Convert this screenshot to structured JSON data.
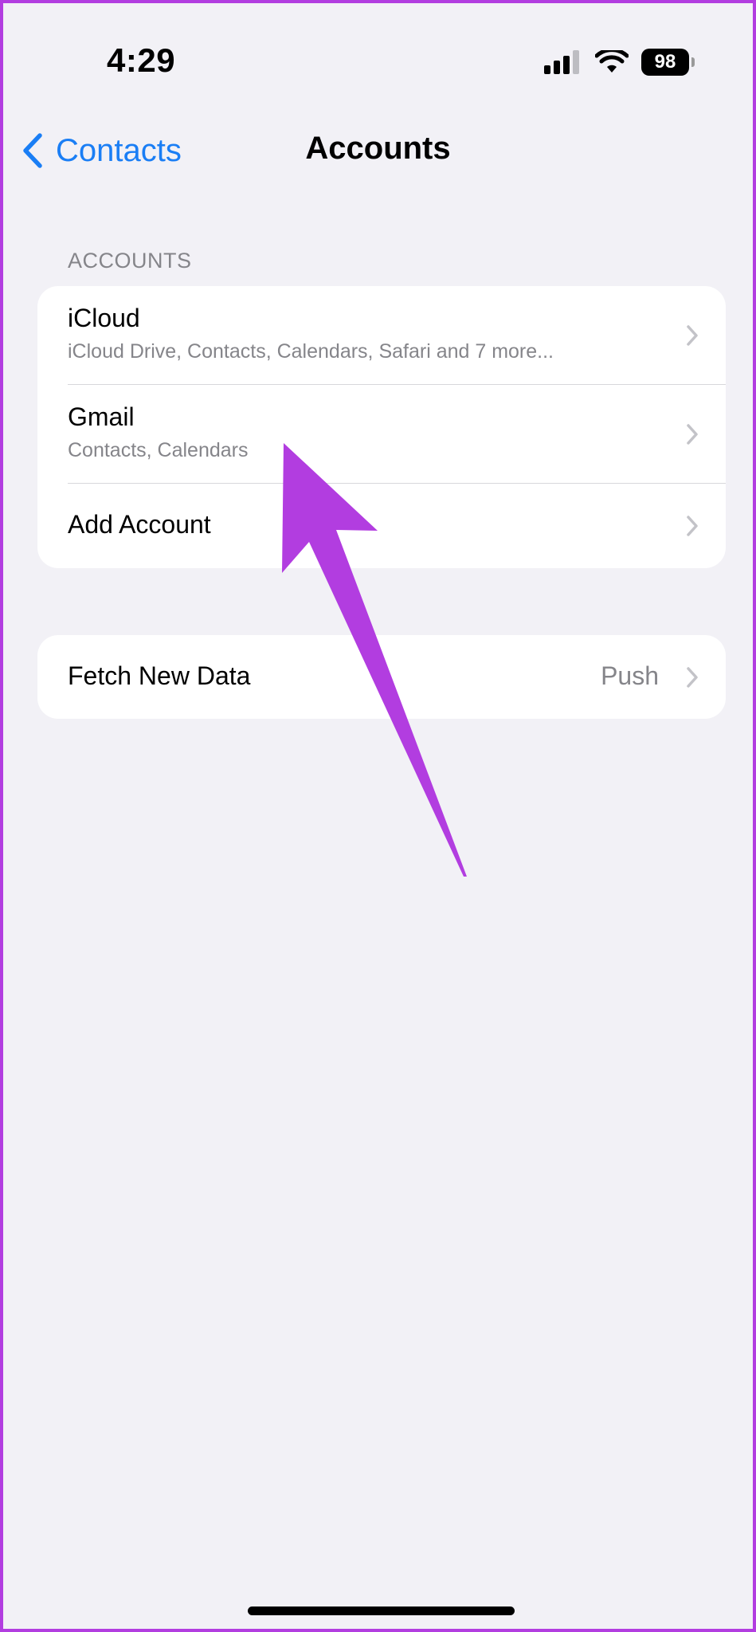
{
  "status_bar": {
    "time": "4:29",
    "battery_level": "98",
    "icons": [
      "cellular-signal-icon",
      "wifi-icon",
      "battery-icon"
    ]
  },
  "nav": {
    "back_label": "Contacts",
    "title": "Accounts"
  },
  "accounts_section": {
    "header": "ACCOUNTS",
    "rows": [
      {
        "title": "iCloud",
        "subtitle": "iCloud Drive, Contacts, Calendars, Safari and 7 more..."
      },
      {
        "title": "Gmail",
        "subtitle": "Contacts, Calendars"
      },
      {
        "title": "Add Account"
      }
    ]
  },
  "fetch_section": {
    "label": "Fetch New Data",
    "value": "Push"
  },
  "colors": {
    "accent_blue": "#1a7ef5",
    "annotation_purple": "#b23de0",
    "background": "#f2f1f6",
    "secondary_text": "#85858a"
  }
}
